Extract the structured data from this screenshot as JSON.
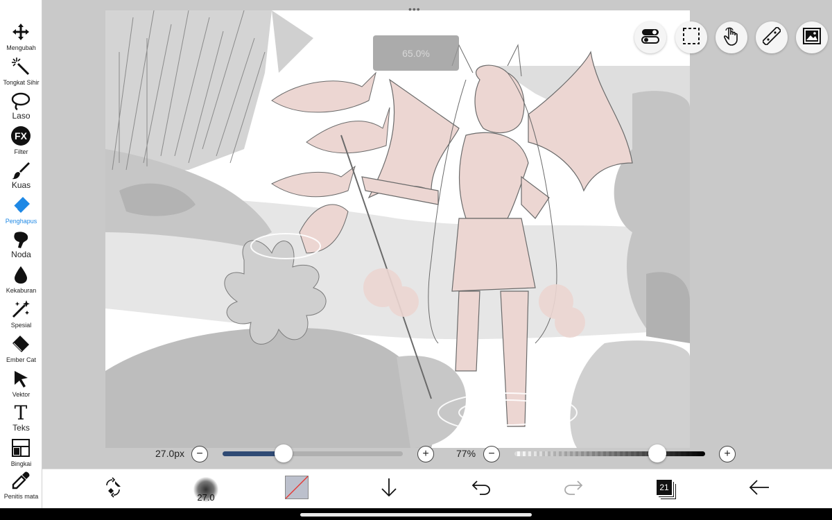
{
  "toolbar": {
    "tools": [
      {
        "label": "Mengubah",
        "icon": "move-icon",
        "size": "small"
      },
      {
        "label": "Tongkat Sihir",
        "icon": "magic-wand-icon",
        "size": "small"
      },
      {
        "label": "Laso",
        "icon": "lasso-icon",
        "size": "big"
      },
      {
        "label": "Filter",
        "icon": "fx-filter-icon",
        "size": "small",
        "icon_text": "FX"
      },
      {
        "label": "Kuas",
        "icon": "brush-icon",
        "size": "big"
      },
      {
        "label": "Penghapus",
        "icon": "eraser-icon",
        "size": "small",
        "active": true
      },
      {
        "label": "Noda",
        "icon": "smudge-icon",
        "size": "big"
      },
      {
        "label": "Kekaburan",
        "icon": "blur-drop-icon",
        "size": "small"
      },
      {
        "label": "Spesial",
        "icon": "sparkle-wand-icon",
        "size": "small"
      },
      {
        "label": "Ember Cat",
        "icon": "paint-bucket-icon",
        "size": "small"
      },
      {
        "label": "Vektor",
        "icon": "vector-arrow-icon",
        "size": "small"
      },
      {
        "label": "Teks",
        "icon": "text-icon",
        "size": "big",
        "icon_text": "T"
      },
      {
        "label": "Bingkai",
        "icon": "frame-icon",
        "size": "small"
      },
      {
        "label": "Penitis mata",
        "icon": "eyedropper-icon",
        "size": "small"
      }
    ]
  },
  "overlay": {
    "opacity_toast": "65.0%"
  },
  "top_buttons": [
    "toggle-settings-icon",
    "selection-icon",
    "hand-touch-icon",
    "ruler-icon",
    "image-icon"
  ],
  "brush_size": {
    "value_text": "27.0px",
    "fraction": 0.34
  },
  "opacity": {
    "value_text": "77%",
    "fraction": 0.75
  },
  "bottom_bar": {
    "brush_preview_label": "27.0",
    "layer_count": "21",
    "icons": [
      "transform-eraser-icon",
      "brush-preview-icon",
      "color-swatch-icon",
      "download-arrow-icon",
      "undo-icon",
      "redo-icon",
      "layers-icon",
      "back-arrow-icon"
    ]
  },
  "colors": {
    "active_tool": "#1e88e5",
    "size_fill": "#2f4a74",
    "sketch_line": "#6a6a6a",
    "skin_tint": "#ecd6d2",
    "rock_gray": "#bdbdbd"
  }
}
